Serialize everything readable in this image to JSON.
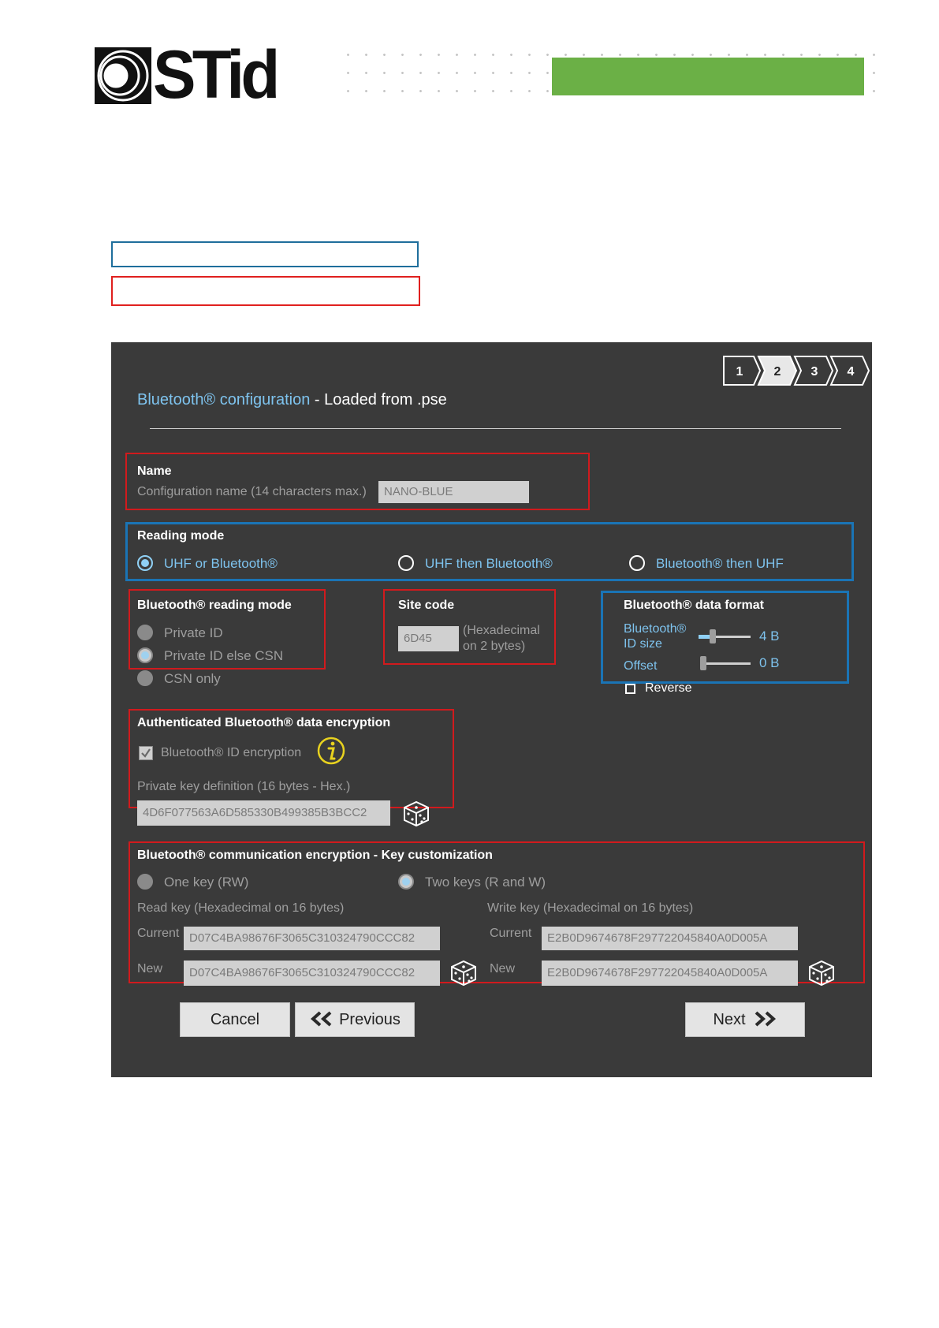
{
  "logo": {
    "text": "STid"
  },
  "steps": [
    "1",
    "2",
    "3",
    "4"
  ],
  "dialog": {
    "title_highlight": "Bluetooth® configuration",
    "title_rest": " - Loaded from .pse"
  },
  "name_section": {
    "title": "Name",
    "label": "Configuration name (14 characters max.)",
    "value": "NANO-BLUE"
  },
  "reading_mode": {
    "title": "Reading mode",
    "options": [
      "UHF or Bluetooth®",
      "UHF then Bluetooth®",
      "Bluetooth® then UHF"
    ],
    "selected": "UHF or Bluetooth®"
  },
  "bt_reading_mode": {
    "title": "Bluetooth® reading mode",
    "options": [
      "Private ID",
      "Private ID else CSN",
      "CSN only"
    ],
    "selected": "Private ID else CSN"
  },
  "site_code": {
    "title": "Site code",
    "value": "6D45",
    "hint_line1": "(Hexadecimal",
    "hint_line2": "on 2 bytes)"
  },
  "data_format": {
    "title": "Bluetooth® data format",
    "id_size_label_1": "Bluetooth®",
    "id_size_label_2": "ID size",
    "id_size_value": "4 B",
    "offset_label": "Offset",
    "offset_value": "0 B",
    "reverse_label": "Reverse",
    "reverse_checked": false
  },
  "auth_encryption": {
    "title": "Authenticated Bluetooth® data encryption",
    "checkbox_label": "Bluetooth® ID encryption",
    "checked": true,
    "key_label": "Private key definition (16 bytes - Hex.)",
    "key_value": "4D6F077563A6D585330B499385B3BCC2"
  },
  "comm_encryption": {
    "title": "Bluetooth® communication encryption - Key customization",
    "option_one": "One key (RW)",
    "option_two": "Two keys (R and W)",
    "selected": "Two keys (R and W)",
    "read_key_label": "Read key (Hexadecimal on 16 bytes)",
    "write_key_label": "Write key (Hexadecimal on 16 bytes)",
    "current_label": "Current",
    "new_label": "New",
    "read_current": "D07C4BA98676F3065C310324790CCC82",
    "read_new": "D07C4BA98676F3065C310324790CCC82",
    "write_current": "E2B0D9674678F297722045840A0D005A",
    "write_new": "E2B0D9674678F297722045840A0D005A"
  },
  "buttons": {
    "cancel": "Cancel",
    "previous": "Previous",
    "next": "Next"
  },
  "colors": {
    "dialog_bg": "#3a3a3a",
    "accent_blue": "#7ec3ee",
    "frame_red": "#d11a1d",
    "frame_blue": "#1a74b5",
    "header_green": "#6bb046"
  }
}
